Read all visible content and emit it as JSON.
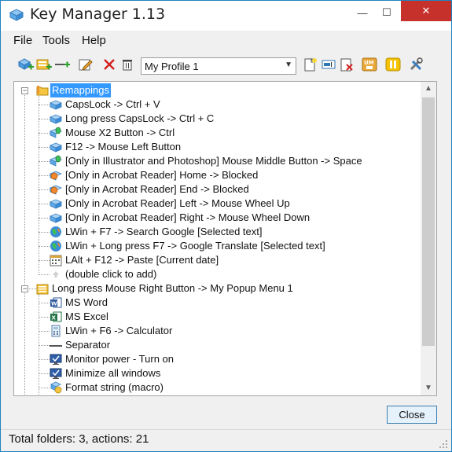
{
  "window": {
    "title": "Key Manager 1.13",
    "minimize_label": "—",
    "maximize_label": "☐",
    "close_label": "✕"
  },
  "menu": {
    "items": [
      "File",
      "Tools",
      "Help"
    ]
  },
  "toolbar": {
    "profile_value": "My Profile 1",
    "buttons": [
      "add-key-icon",
      "add-folder-icon",
      "add-separator-icon",
      "edit-icon",
      "delete-icon",
      "trash-icon",
      "new-profile-icon",
      "rename-profile-icon",
      "delete-profile-icon",
      "um-icon",
      "pause-icon",
      "settings-icon"
    ]
  },
  "tree": {
    "rows": [
      {
        "label": "Remappings",
        "icon": "folder-icon"
      },
      {
        "label": "CapsLock -> Ctrl + V",
        "icon": "key-icon"
      },
      {
        "label": "Long press CapsLock -> Ctrl + C",
        "icon": "key-icon"
      },
      {
        "label": "Mouse X2 Button -> Ctrl",
        "icon": "mouse-key-icon"
      },
      {
        "label": "F12 -> Mouse Left Button",
        "icon": "key-icon"
      },
      {
        "label": "[Only in Illustrator and Photoshop] Mouse Middle Button -> Space",
        "icon": "mouse-key-icon"
      },
      {
        "label": "[Only in Acrobat Reader] Home -> Blocked",
        "icon": "blocked-key-icon"
      },
      {
        "label": "[Only in Acrobat Reader] End -> Blocked",
        "icon": "blocked-key-icon"
      },
      {
        "label": "[Only in Acrobat Reader] Left -> Mouse Wheel Up",
        "icon": "key-icon"
      },
      {
        "label": "[Only in Acrobat Reader] Right -> Mouse Wheel Down",
        "icon": "key-icon"
      },
      {
        "label": "LWin + F7 -> Search Google [Selected text]",
        "icon": "web-icon"
      },
      {
        "label": "LWin + Long press F7 -> Google Translate [Selected text]",
        "icon": "web-icon"
      },
      {
        "label": "LAlt + F12 -> Paste [Current date]",
        "icon": "calendar-icon"
      },
      {
        "label": "(double click to add)",
        "icon": "add-arrow-icon"
      },
      {
        "label": "Long press Mouse Right Button -> My Popup Menu 1",
        "icon": "popup-menu-icon"
      },
      {
        "label": "MS Word",
        "icon": "word-icon"
      },
      {
        "label": "MS Excel",
        "icon": "excel-icon"
      },
      {
        "label": "LWin + F6 -> Calculator",
        "icon": "calculator-icon"
      },
      {
        "label": "Separator",
        "icon": "separator-icon"
      },
      {
        "label": "Monitor power - Turn on",
        "icon": "monitor-icon"
      },
      {
        "label": "Minimize all windows",
        "icon": "monitor-icon"
      },
      {
        "label": "Format string (macro)",
        "icon": "macro-icon"
      }
    ]
  },
  "buttons": {
    "close_label": "Close"
  },
  "status": {
    "text": "Total folders: 3, actions: 21"
  },
  "colors": {
    "selection": "#3399ff",
    "close_hover": "#c7312c",
    "accent": "#1e83c3"
  }
}
